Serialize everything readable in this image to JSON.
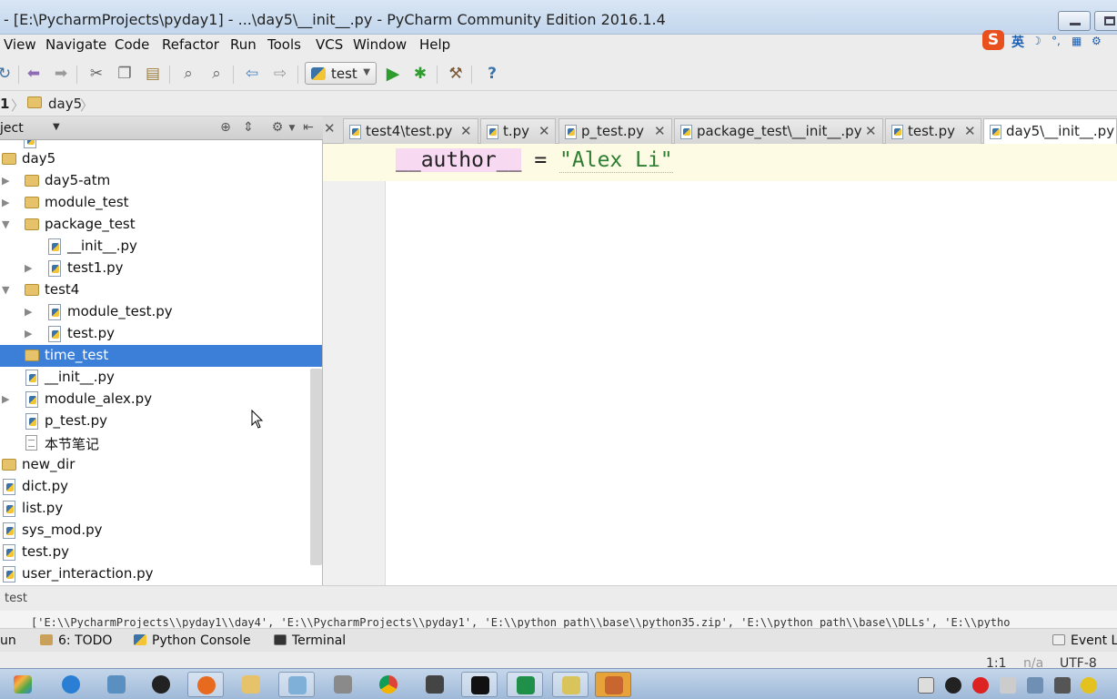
{
  "window": {
    "title": "- [E:\\PycharmProjects\\pyday1] - ...\\day5\\__init__.py - PyCharm Community Edition 2016.1.4"
  },
  "menu": [
    "View",
    "Navigate",
    "Code",
    "Refactor",
    "Run",
    "Tools",
    "VCS",
    "Window",
    "Help"
  ],
  "ime": {
    "lang": "英",
    "logo": "S"
  },
  "toolbar": {
    "run_config": "test",
    "help": "?"
  },
  "breadcrumb": {
    "project": "1",
    "folder": "day5"
  },
  "project_panel": {
    "title": "ject"
  },
  "tree": [
    {
      "label": "day5",
      "type": "folder"
    },
    {
      "label": "day5-atm",
      "type": "folder"
    },
    {
      "label": "module_test",
      "type": "folder"
    },
    {
      "label": "package_test",
      "type": "folder"
    },
    {
      "label": "__init__.py",
      "type": "py"
    },
    {
      "label": "test1.py",
      "type": "py"
    },
    {
      "label": "test4",
      "type": "folder"
    },
    {
      "label": "module_test.py",
      "type": "py"
    },
    {
      "label": "test.py",
      "type": "py"
    },
    {
      "label": "time_test",
      "type": "folder"
    },
    {
      "label": "__init__.py",
      "type": "py"
    },
    {
      "label": "module_alex.py",
      "type": "py"
    },
    {
      "label": "p_test.py",
      "type": "py"
    },
    {
      "label": "本节笔记",
      "type": "txt"
    },
    {
      "label": "new_dir",
      "type": "folder"
    },
    {
      "label": "dict.py",
      "type": "py"
    },
    {
      "label": "list.py",
      "type": "py"
    },
    {
      "label": "sys_mod.py",
      "type": "py"
    },
    {
      "label": "test.py",
      "type": "py"
    },
    {
      "label": "user_interaction.py",
      "type": "py"
    }
  ],
  "tabs": [
    "test4\\test.py",
    "t.py",
    "p_test.py",
    "package_test\\__init__.py",
    "test.py",
    "day5\\__init__.py"
  ],
  "editor": {
    "ident": "__author__",
    "op": " = ",
    "string": "\"Alex Li\""
  },
  "bottom": {
    "run_label": "test",
    "console_text": "['E:\\\\PycharmProjects\\\\pyday1\\\\day4', 'E:\\\\PycharmProjects\\\\pyday1', 'E:\\\\python_path\\\\base\\\\python35.zip', 'E:\\\\python_path\\\\base\\\\DLLs', 'E:\\\\pytho",
    "toolwindows": {
      "run": "un",
      "todo": "6: TODO",
      "python_console": "Python Console",
      "terminal": "Terminal",
      "event_log": "Event Lo"
    },
    "status": {
      "position": "1:1",
      "na": "n/a",
      "encoding": "UTF-8"
    }
  },
  "colors": {
    "selection": "#3b7fd9",
    "string": "#2e7d32",
    "ident_bg": "#f8d9f2",
    "current_line": "#fdfbe3"
  }
}
